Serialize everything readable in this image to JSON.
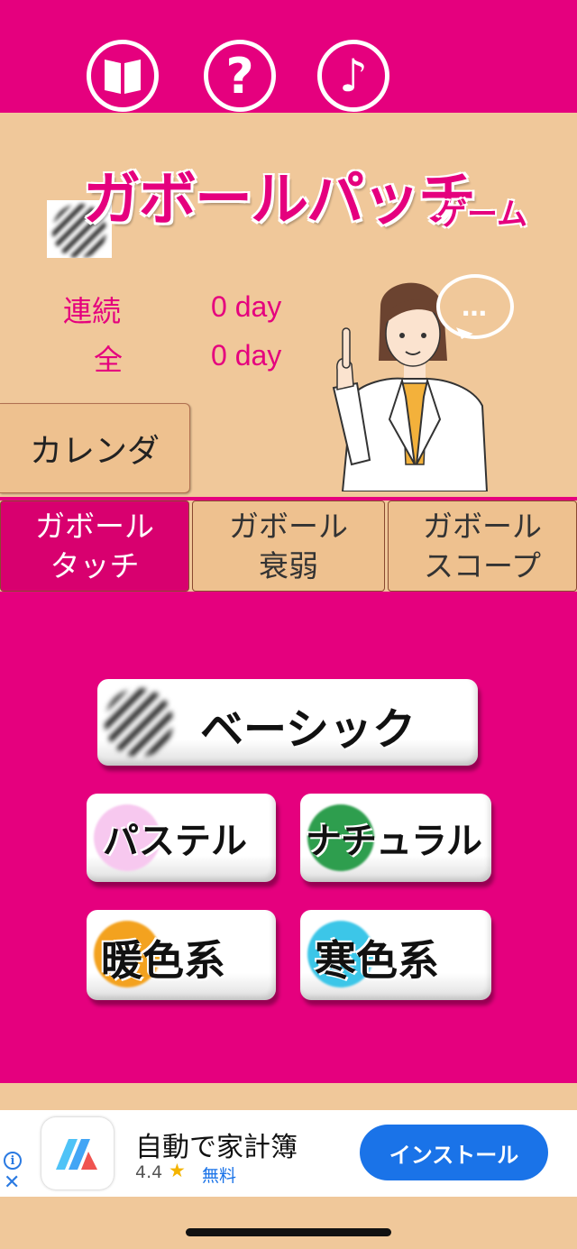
{
  "top_bar": {
    "icons": [
      "book-icon",
      "help-icon",
      "music-icon"
    ],
    "help_symbol": "?",
    "music_symbol": "♪"
  },
  "logo": {
    "title": "ガボールパッチ",
    "subtitle": "ゲーム"
  },
  "stats": {
    "streak_label": "連続",
    "streak_value": "0 day",
    "total_label": "全",
    "total_value": "0 day"
  },
  "speech_bubble": "…",
  "calendar_button": "カレンダ",
  "tabs": [
    {
      "line1": "ガボール",
      "line2": "タッチ",
      "active": true
    },
    {
      "line1": "ガボール",
      "line2": "衰弱",
      "active": false
    },
    {
      "line1": "ガボール",
      "line2": "スコープ",
      "active": false
    }
  ],
  "modes": {
    "basic": "ベーシック",
    "pastel": "パステル",
    "natural": "ナチュラル",
    "warm": "暖色系",
    "cold": "寒色系"
  },
  "colors": {
    "primary_pink": "#e5007e",
    "beige": "#f0c89a",
    "pastel_dot": "#f7c8ef",
    "natural_dot": "#2e9e4e",
    "warm_dot": "#f3a21f",
    "cold_dot": "#3cc6e8"
  },
  "ad": {
    "title": "自動で家計簿",
    "rating": "4.4",
    "star": "★",
    "price": "無料",
    "install": "インストール",
    "info_symbol": "i",
    "close_symbol": "✕"
  }
}
